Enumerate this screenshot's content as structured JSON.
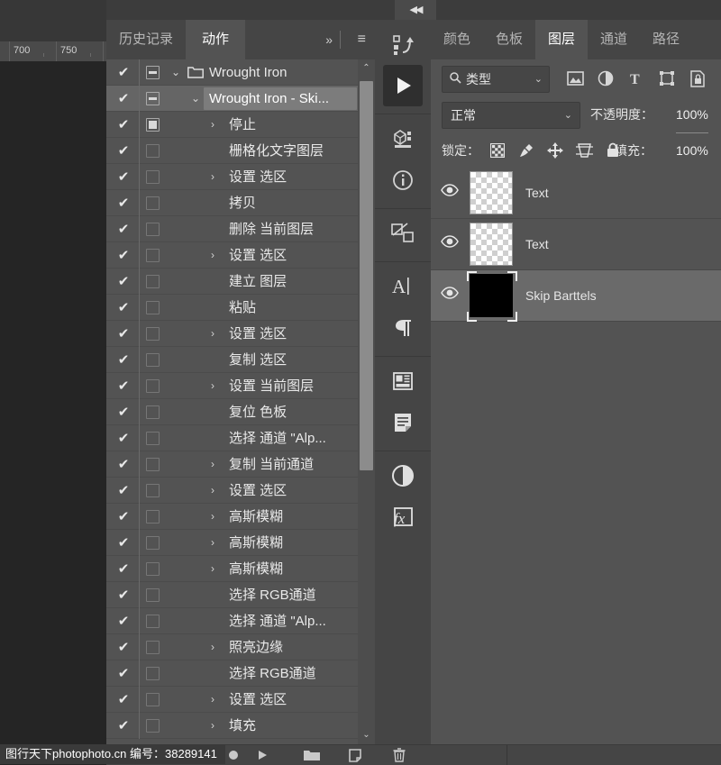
{
  "app": {
    "collapse_label": "◀◀"
  },
  "canvas": {
    "ruler_marks": [
      "700",
      "750"
    ]
  },
  "actions_panel": {
    "tabs": [
      {
        "label": "历史记录",
        "active": false
      },
      {
        "label": "动作",
        "active": true
      }
    ],
    "chevron_label": "»",
    "menu_label": "≡",
    "rows": [
      {
        "check": "✔",
        "toggle": "dialog-on",
        "twisty": "⌄",
        "icon": "folder",
        "label": "Wrought Iron",
        "indent": 0,
        "selected": false
      },
      {
        "check": "✔",
        "toggle": "dialog-on",
        "twisty": "⌄",
        "icon": "none",
        "label": "Wrought Iron - Ski...",
        "indent": 1,
        "selected": true
      },
      {
        "check": "✔",
        "toggle": "dialog-on2",
        "twisty": "›",
        "icon": "none",
        "label": "停止",
        "indent": 2,
        "selected": false
      },
      {
        "check": "✔",
        "toggle": "empty",
        "twisty": "",
        "icon": "none",
        "label": "栅格化文字图层",
        "indent": 2,
        "selected": false
      },
      {
        "check": "✔",
        "toggle": "empty",
        "twisty": "›",
        "icon": "none",
        "label": "设置 选区",
        "indent": 2,
        "selected": false
      },
      {
        "check": "✔",
        "toggle": "empty",
        "twisty": "",
        "icon": "none",
        "label": "拷贝",
        "indent": 2,
        "selected": false
      },
      {
        "check": "✔",
        "toggle": "empty",
        "twisty": "",
        "icon": "none",
        "label": "删除 当前图层",
        "indent": 2,
        "selected": false
      },
      {
        "check": "✔",
        "toggle": "empty",
        "twisty": "›",
        "icon": "none",
        "label": "设置 选区",
        "indent": 2,
        "selected": false
      },
      {
        "check": "✔",
        "toggle": "empty",
        "twisty": "",
        "icon": "none",
        "label": "建立 图层",
        "indent": 2,
        "selected": false
      },
      {
        "check": "✔",
        "toggle": "empty",
        "twisty": "",
        "icon": "none",
        "label": "粘贴",
        "indent": 2,
        "selected": false
      },
      {
        "check": "✔",
        "toggle": "empty",
        "twisty": "›",
        "icon": "none",
        "label": "设置 选区",
        "indent": 2,
        "selected": false
      },
      {
        "check": "✔",
        "toggle": "empty",
        "twisty": "",
        "icon": "none",
        "label": "复制 选区",
        "indent": 2,
        "selected": false
      },
      {
        "check": "✔",
        "toggle": "empty",
        "twisty": "›",
        "icon": "none",
        "label": "设置 当前图层",
        "indent": 2,
        "selected": false
      },
      {
        "check": "✔",
        "toggle": "empty",
        "twisty": "",
        "icon": "none",
        "label": "复位 色板",
        "indent": 2,
        "selected": false
      },
      {
        "check": "✔",
        "toggle": "empty",
        "twisty": "",
        "icon": "none",
        "label": "选择 通道 \"Alp...",
        "indent": 2,
        "selected": false
      },
      {
        "check": "✔",
        "toggle": "empty",
        "twisty": "›",
        "icon": "none",
        "label": "复制 当前通道",
        "indent": 2,
        "selected": false
      },
      {
        "check": "✔",
        "toggle": "empty",
        "twisty": "›",
        "icon": "none",
        "label": "设置 选区",
        "indent": 2,
        "selected": false
      },
      {
        "check": "✔",
        "toggle": "empty",
        "twisty": "›",
        "icon": "none",
        "label": "高斯模糊",
        "indent": 2,
        "selected": false
      },
      {
        "check": "✔",
        "toggle": "empty",
        "twisty": "›",
        "icon": "none",
        "label": "高斯模糊",
        "indent": 2,
        "selected": false
      },
      {
        "check": "✔",
        "toggle": "empty",
        "twisty": "›",
        "icon": "none",
        "label": "高斯模糊",
        "indent": 2,
        "selected": false
      },
      {
        "check": "✔",
        "toggle": "empty",
        "twisty": "",
        "icon": "none",
        "label": "选择 RGB通道",
        "indent": 2,
        "selected": false
      },
      {
        "check": "✔",
        "toggle": "empty",
        "twisty": "",
        "icon": "none",
        "label": "选择 通道 \"Alp...",
        "indent": 2,
        "selected": false
      },
      {
        "check": "✔",
        "toggle": "empty",
        "twisty": "›",
        "icon": "none",
        "label": "照亮边缘",
        "indent": 2,
        "selected": false
      },
      {
        "check": "✔",
        "toggle": "empty",
        "twisty": "",
        "icon": "none",
        "label": "选择 RGB通道",
        "indent": 2,
        "selected": false
      },
      {
        "check": "✔",
        "toggle": "empty",
        "twisty": "›",
        "icon": "none",
        "label": "设置 选区",
        "indent": 2,
        "selected": false
      },
      {
        "check": "✔",
        "toggle": "empty",
        "twisty": "›",
        "icon": "none",
        "label": "填充",
        "indent": 2,
        "selected": false
      }
    ],
    "scrollbar": {
      "up": "⌃",
      "down": "⌄"
    }
  },
  "rail": {
    "icons": [
      {
        "name": "actions-icon",
        "active": false
      },
      {
        "name": "play-icon",
        "active": true
      },
      {
        "name": "3d-icon",
        "active": false
      },
      {
        "name": "info-icon",
        "active": false
      },
      {
        "name": "path-select-icon",
        "active": false
      },
      {
        "name": "character-icon",
        "active": false
      },
      {
        "name": "paragraph-icon",
        "active": false
      },
      {
        "name": "layout-icon",
        "active": false
      },
      {
        "name": "notes-icon",
        "active": false
      },
      {
        "name": "adjustments-icon",
        "active": false
      },
      {
        "name": "fx-icon",
        "active": false
      }
    ]
  },
  "layers_panel": {
    "tabs": [
      {
        "label": "颜色",
        "active": false
      },
      {
        "label": "色板",
        "active": false
      },
      {
        "label": "图层",
        "active": true
      },
      {
        "label": "通道",
        "active": false
      },
      {
        "label": "路径",
        "active": false
      }
    ],
    "filter": {
      "search_icon": "search-icon",
      "type_label": "类型",
      "chevron": "⌄",
      "icons": [
        "pixel-layer-icon",
        "adjustment-layer-icon",
        "type-layer-icon",
        "shape-layer-icon",
        "smart-object-icon"
      ]
    },
    "blend": {
      "mode": "正常",
      "chevron": "⌄",
      "opacity_label": "不透明度：",
      "opacity_value": "100%"
    },
    "lock": {
      "label": "锁定：",
      "icons": [
        "lock-transparency-icon",
        "lock-image-icon",
        "lock-position-icon",
        "lock-artboard-icon",
        "lock-all-icon"
      ],
      "fill_label": "填充：",
      "fill_value": "100%"
    },
    "layers": [
      {
        "name": "Text",
        "thumb": "checker",
        "visible": true,
        "selected": false
      },
      {
        "name": "Text",
        "thumb": "checker",
        "visible": true,
        "selected": false
      },
      {
        "name": "Skip Barttels",
        "thumb": "black",
        "visible": true,
        "selected": true
      }
    ]
  },
  "bottom_bar": {
    "buttons": [
      "stop-icon",
      "record-icon",
      "play-icon",
      "new-set-icon",
      "new-action-icon",
      "delete-icon"
    ]
  },
  "watermark": {
    "text": "图行天下photophoto.cn 编号：38289141"
  }
}
